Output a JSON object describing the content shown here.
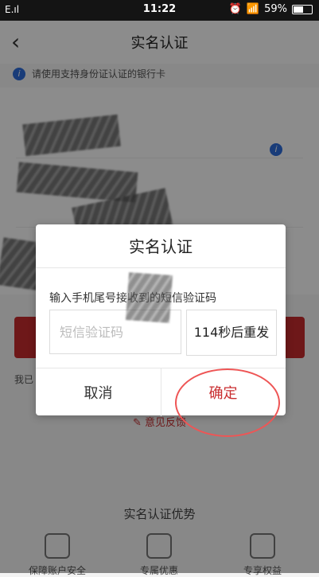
{
  "status_bar": {
    "carrier": "E.ıl",
    "time": "11:22",
    "battery": "59%"
  },
  "app_bar": {
    "title": "实名认证"
  },
  "background": {
    "tip": "请使用支持身份证认证的银行卡",
    "small_text": "我已",
    "feedback": "意见反馈",
    "benefits_title": "实名认证优势",
    "benefits": [
      {
        "label": "保障账户安全",
        "icon": "shield-icon"
      },
      {
        "label": "专属优惠",
        "icon": "bag-icon"
      },
      {
        "label": "专享权益",
        "icon": "gift-icon"
      }
    ]
  },
  "modal": {
    "title": "实名认证",
    "desc": "输入手机尾号接收到的短信验证码",
    "otp_placeholder": "短信验证码",
    "resend_label": "114秒后重发",
    "cancel_label": "取消",
    "confirm_label": "确定"
  },
  "colors": {
    "accent": "#c92d2f",
    "overlay": "#000000"
  }
}
